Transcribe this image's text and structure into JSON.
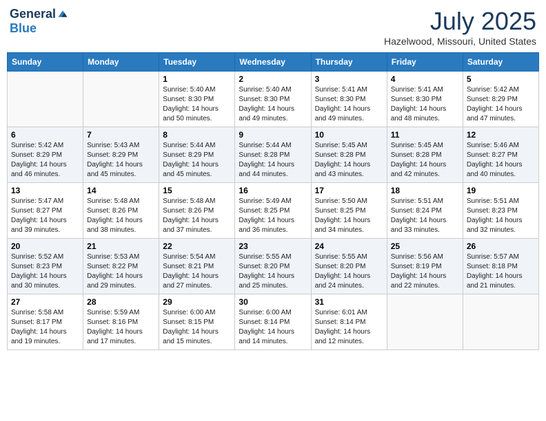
{
  "header": {
    "logo_general": "General",
    "logo_blue": "Blue",
    "month_title": "July 2025",
    "location": "Hazelwood, Missouri, United States"
  },
  "days_of_week": [
    "Sunday",
    "Monday",
    "Tuesday",
    "Wednesday",
    "Thursday",
    "Friday",
    "Saturday"
  ],
  "weeks": [
    [
      {
        "day": "",
        "sunrise": "",
        "sunset": "",
        "daylight": ""
      },
      {
        "day": "",
        "sunrise": "",
        "sunset": "",
        "daylight": ""
      },
      {
        "day": "1",
        "sunrise": "Sunrise: 5:40 AM",
        "sunset": "Sunset: 8:30 PM",
        "daylight": "Daylight: 14 hours and 50 minutes."
      },
      {
        "day": "2",
        "sunrise": "Sunrise: 5:40 AM",
        "sunset": "Sunset: 8:30 PM",
        "daylight": "Daylight: 14 hours and 49 minutes."
      },
      {
        "day": "3",
        "sunrise": "Sunrise: 5:41 AM",
        "sunset": "Sunset: 8:30 PM",
        "daylight": "Daylight: 14 hours and 49 minutes."
      },
      {
        "day": "4",
        "sunrise": "Sunrise: 5:41 AM",
        "sunset": "Sunset: 8:30 PM",
        "daylight": "Daylight: 14 hours and 48 minutes."
      },
      {
        "day": "5",
        "sunrise": "Sunrise: 5:42 AM",
        "sunset": "Sunset: 8:29 PM",
        "daylight": "Daylight: 14 hours and 47 minutes."
      }
    ],
    [
      {
        "day": "6",
        "sunrise": "Sunrise: 5:42 AM",
        "sunset": "Sunset: 8:29 PM",
        "daylight": "Daylight: 14 hours and 46 minutes."
      },
      {
        "day": "7",
        "sunrise": "Sunrise: 5:43 AM",
        "sunset": "Sunset: 8:29 PM",
        "daylight": "Daylight: 14 hours and 45 minutes."
      },
      {
        "day": "8",
        "sunrise": "Sunrise: 5:44 AM",
        "sunset": "Sunset: 8:29 PM",
        "daylight": "Daylight: 14 hours and 45 minutes."
      },
      {
        "day": "9",
        "sunrise": "Sunrise: 5:44 AM",
        "sunset": "Sunset: 8:28 PM",
        "daylight": "Daylight: 14 hours and 44 minutes."
      },
      {
        "day": "10",
        "sunrise": "Sunrise: 5:45 AM",
        "sunset": "Sunset: 8:28 PM",
        "daylight": "Daylight: 14 hours and 43 minutes."
      },
      {
        "day": "11",
        "sunrise": "Sunrise: 5:45 AM",
        "sunset": "Sunset: 8:28 PM",
        "daylight": "Daylight: 14 hours and 42 minutes."
      },
      {
        "day": "12",
        "sunrise": "Sunrise: 5:46 AM",
        "sunset": "Sunset: 8:27 PM",
        "daylight": "Daylight: 14 hours and 40 minutes."
      }
    ],
    [
      {
        "day": "13",
        "sunrise": "Sunrise: 5:47 AM",
        "sunset": "Sunset: 8:27 PM",
        "daylight": "Daylight: 14 hours and 39 minutes."
      },
      {
        "day": "14",
        "sunrise": "Sunrise: 5:48 AM",
        "sunset": "Sunset: 8:26 PM",
        "daylight": "Daylight: 14 hours and 38 minutes."
      },
      {
        "day": "15",
        "sunrise": "Sunrise: 5:48 AM",
        "sunset": "Sunset: 8:26 PM",
        "daylight": "Daylight: 14 hours and 37 minutes."
      },
      {
        "day": "16",
        "sunrise": "Sunrise: 5:49 AM",
        "sunset": "Sunset: 8:25 PM",
        "daylight": "Daylight: 14 hours and 36 minutes."
      },
      {
        "day": "17",
        "sunrise": "Sunrise: 5:50 AM",
        "sunset": "Sunset: 8:25 PM",
        "daylight": "Daylight: 14 hours and 34 minutes."
      },
      {
        "day": "18",
        "sunrise": "Sunrise: 5:51 AM",
        "sunset": "Sunset: 8:24 PM",
        "daylight": "Daylight: 14 hours and 33 minutes."
      },
      {
        "day": "19",
        "sunrise": "Sunrise: 5:51 AM",
        "sunset": "Sunset: 8:23 PM",
        "daylight": "Daylight: 14 hours and 32 minutes."
      }
    ],
    [
      {
        "day": "20",
        "sunrise": "Sunrise: 5:52 AM",
        "sunset": "Sunset: 8:23 PM",
        "daylight": "Daylight: 14 hours and 30 minutes."
      },
      {
        "day": "21",
        "sunrise": "Sunrise: 5:53 AM",
        "sunset": "Sunset: 8:22 PM",
        "daylight": "Daylight: 14 hours and 29 minutes."
      },
      {
        "day": "22",
        "sunrise": "Sunrise: 5:54 AM",
        "sunset": "Sunset: 8:21 PM",
        "daylight": "Daylight: 14 hours and 27 minutes."
      },
      {
        "day": "23",
        "sunrise": "Sunrise: 5:55 AM",
        "sunset": "Sunset: 8:20 PM",
        "daylight": "Daylight: 14 hours and 25 minutes."
      },
      {
        "day": "24",
        "sunrise": "Sunrise: 5:55 AM",
        "sunset": "Sunset: 8:20 PM",
        "daylight": "Daylight: 14 hours and 24 minutes."
      },
      {
        "day": "25",
        "sunrise": "Sunrise: 5:56 AM",
        "sunset": "Sunset: 8:19 PM",
        "daylight": "Daylight: 14 hours and 22 minutes."
      },
      {
        "day": "26",
        "sunrise": "Sunrise: 5:57 AM",
        "sunset": "Sunset: 8:18 PM",
        "daylight": "Daylight: 14 hours and 21 minutes."
      }
    ],
    [
      {
        "day": "27",
        "sunrise": "Sunrise: 5:58 AM",
        "sunset": "Sunset: 8:17 PM",
        "daylight": "Daylight: 14 hours and 19 minutes."
      },
      {
        "day": "28",
        "sunrise": "Sunrise: 5:59 AM",
        "sunset": "Sunset: 8:16 PM",
        "daylight": "Daylight: 14 hours and 17 minutes."
      },
      {
        "day": "29",
        "sunrise": "Sunrise: 6:00 AM",
        "sunset": "Sunset: 8:15 PM",
        "daylight": "Daylight: 14 hours and 15 minutes."
      },
      {
        "day": "30",
        "sunrise": "Sunrise: 6:00 AM",
        "sunset": "Sunset: 8:14 PM",
        "daylight": "Daylight: 14 hours and 14 minutes."
      },
      {
        "day": "31",
        "sunrise": "Sunrise: 6:01 AM",
        "sunset": "Sunset: 8:14 PM",
        "daylight": "Daylight: 14 hours and 12 minutes."
      },
      {
        "day": "",
        "sunrise": "",
        "sunset": "",
        "daylight": ""
      },
      {
        "day": "",
        "sunrise": "",
        "sunset": "",
        "daylight": ""
      }
    ]
  ]
}
